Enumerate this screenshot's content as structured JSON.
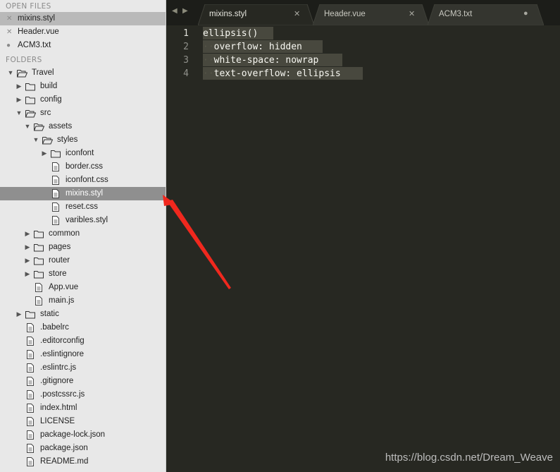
{
  "sidebar": {
    "open_files_title": "OPEN FILES",
    "open_files": [
      {
        "label": "mixins.styl",
        "mark": "✕"
      },
      {
        "label": "Header.vue",
        "mark": "✕"
      },
      {
        "label": "ACM3.txt",
        "mark": "●"
      }
    ],
    "folders_title": "FOLDERS",
    "tree": [
      {
        "label": "Travel",
        "arrow": "▼"
      },
      {
        "label": "build",
        "arrow": "▶"
      },
      {
        "label": "config",
        "arrow": "▶"
      },
      {
        "label": "src",
        "arrow": "▼"
      },
      {
        "label": "assets",
        "arrow": "▼"
      },
      {
        "label": "styles",
        "arrow": "▼"
      },
      {
        "label": "iconfont",
        "arrow": "▶"
      },
      {
        "label": "border.css"
      },
      {
        "label": "iconfont.css"
      },
      {
        "label": "mixins.styl"
      },
      {
        "label": "reset.css"
      },
      {
        "label": "varibles.styl"
      },
      {
        "label": "common",
        "arrow": "▶"
      },
      {
        "label": "pages",
        "arrow": "▶"
      },
      {
        "label": "router",
        "arrow": "▶"
      },
      {
        "label": "store",
        "arrow": "▶"
      },
      {
        "label": "App.vue"
      },
      {
        "label": "main.js"
      },
      {
        "label": "static",
        "arrow": "▶"
      },
      {
        "label": ".babelrc"
      },
      {
        "label": ".editorconfig"
      },
      {
        "label": ".eslintignore"
      },
      {
        "label": ".eslintrc.js"
      },
      {
        "label": ".gitignore"
      },
      {
        "label": ".postcssrc.js"
      },
      {
        "label": "index.html"
      },
      {
        "label": "LICENSE"
      },
      {
        "label": "package-lock.json"
      },
      {
        "label": "package.json"
      },
      {
        "label": "README.md"
      }
    ]
  },
  "tabbar": {
    "back": "◀",
    "forward": "▶",
    "tabs": [
      {
        "label": "mixins.styl",
        "close": "✕"
      },
      {
        "label": "Header.vue",
        "close": "✕"
      },
      {
        "label": "ACM3.txt",
        "close": "●"
      }
    ]
  },
  "editor": {
    "line_numbers": [
      "1",
      "2",
      "3",
      "4"
    ],
    "lines": [
      {
        "indent": "",
        "text": "ellipsis()"
      },
      {
        "indent": "··",
        "text": "overflow: hidden"
      },
      {
        "indent": "··",
        "text": "white-space: nowrap"
      },
      {
        "indent": "··",
        "text": "text-overflow: ellipsis"
      }
    ]
  },
  "watermark": "https://blog.csdn.net/Dream_Weave",
  "colors": {
    "editor_bg": "#272822",
    "sidebar_bg": "#e8e8e8",
    "selection": "#48483e",
    "annotation_arrow": "#f0281e"
  }
}
